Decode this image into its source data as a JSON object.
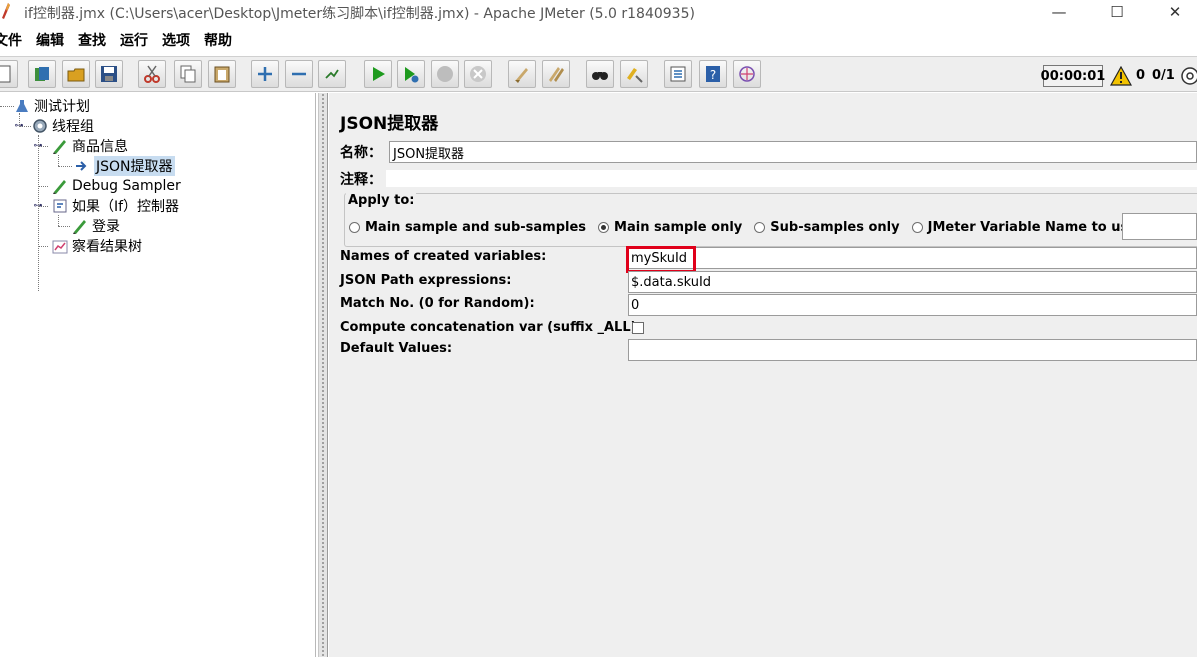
{
  "window": {
    "title": "if控制器.jmx (C:\\Users\\acer\\Desktop\\Jmeter练习脚本\\if控制器.jmx) - Apache JMeter (5.0 r1840935)",
    "min_symbol": "—",
    "max_symbol": "☐",
    "close_symbol": "✕"
  },
  "menu": [
    "文件",
    "编辑",
    "查找",
    "运行",
    "选项",
    "帮助"
  ],
  "toolbar": {
    "buttons": [
      "new-icon",
      "templates-icon",
      "open-icon",
      "save-icon",
      "cut-icon",
      "copy-icon",
      "paste-icon",
      "expand-icon",
      "collapse-icon",
      "toggle-icon",
      "start-icon",
      "start-no-pause-icon",
      "stop-icon",
      "shutdown-icon",
      "clear-icon",
      "clear-all-icon",
      "search-icon",
      "reset-search-icon",
      "function-helper-icon",
      "help-icon",
      "remote-icon"
    ],
    "timer": "00:00:01",
    "warning_count": "0",
    "threads": "0/1"
  },
  "tree": {
    "nodes": [
      {
        "label": "测试计划",
        "icon": "test-plan-icon"
      },
      {
        "label": "线程组",
        "icon": "thread-group-icon"
      },
      {
        "label": "商品信息",
        "icon": "sampler-icon"
      },
      {
        "label": "JSON提取器",
        "icon": "extractor-icon",
        "selected": true
      },
      {
        "label": "Debug Sampler",
        "icon": "sampler-icon"
      },
      {
        "label": "如果（If）控制器",
        "icon": "controller-icon"
      },
      {
        "label": "登录",
        "icon": "sampler-icon"
      },
      {
        "label": "察看结果树",
        "icon": "listener-icon"
      }
    ]
  },
  "editor": {
    "title": "JSON提取器",
    "name_label": "名称：",
    "name_value": "JSON提取器",
    "comment_label": "注释：",
    "apply_to": {
      "legend": "Apply to:",
      "options": [
        "Main sample and sub-samples",
        "Main sample only",
        "Sub-samples only",
        "JMeter Variable Name to use"
      ],
      "selected": "Main sample only"
    },
    "fields": {
      "names_label": "Names of created variables:",
      "names_value": "mySkuId",
      "json_path_label": "JSON Path expressions:",
      "json_path_value": "$.data.skuId",
      "match_label": "Match No. (0 for Random):",
      "match_value": "0",
      "concat_label": "Compute concatenation var (suffix _ALL):",
      "default_label": "Default Values:",
      "default_value": ""
    }
  },
  "colors": {
    "highlight": "#e0001a",
    "selection": "#c7dcf0"
  }
}
